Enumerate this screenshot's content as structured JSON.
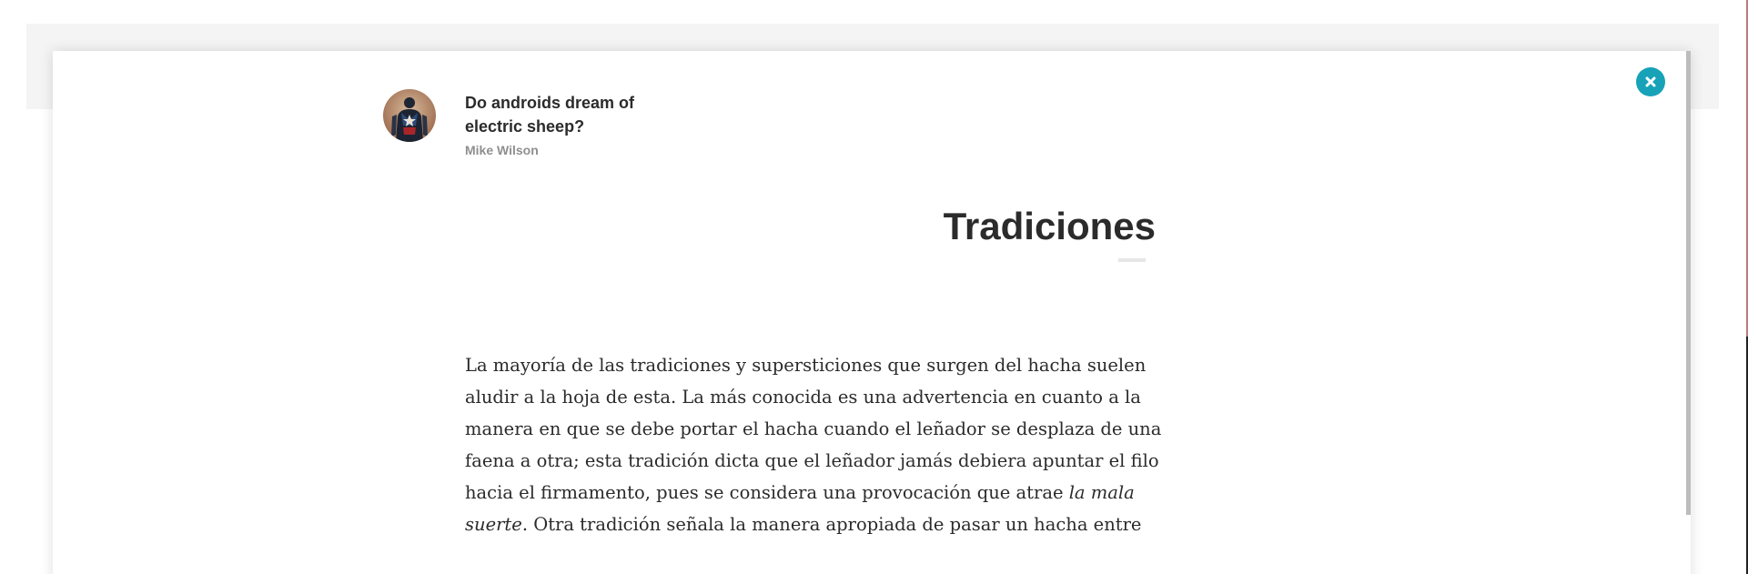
{
  "post": {
    "title": "Do androids dream of electric sheep?",
    "author": "Mike Wilson"
  },
  "article": {
    "title": "Tradiciones",
    "body_before_em": "La mayoría de las tradiciones y supersticiones que surgen del hacha suelen aludir a la hoja de esta. La más conocida es una advertencia en cuanto a la manera en que se debe portar el hacha cuando el leñador se desplaza de una faena a otra; esta tradición dicta que el leñador jamás debiera apuntar el filo hacia el firmamento, pues se considera una provocación que atrae ",
    "body_em": "la mala suerte",
    "body_after_em": ". Otra tradición señala la manera apropiada de pasar un hacha entre"
  },
  "close_button": {
    "label": "×"
  },
  "icons": {
    "close": "close-icon",
    "avatar": "avatar-image"
  },
  "colors": {
    "accent": "#17a2b8",
    "text": "#2b2b2b",
    "muted": "#8f8f8f"
  }
}
